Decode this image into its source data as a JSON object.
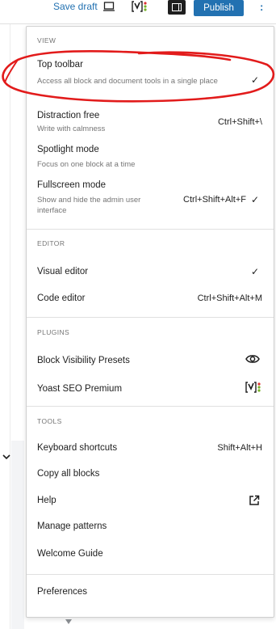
{
  "toolbar": {
    "save_draft": "Save draft",
    "publish": "Publish",
    "more_menu": ":"
  },
  "menu": {
    "sections": {
      "view": "VIEW",
      "editor": "EDITOR",
      "plugins": "PLUGINS",
      "tools": "TOOLS"
    },
    "view_items": {
      "top_toolbar": {
        "label": "Top toolbar",
        "desc": "Access all block and document tools in a single place",
        "check": "✓"
      },
      "distraction_free": {
        "label": "Distraction free",
        "desc": "Write with calmness",
        "shortcut": "Ctrl+Shift+\\"
      },
      "spotlight": {
        "label": "Spotlight mode",
        "desc": "Focus on one block at a time"
      },
      "fullscreen": {
        "label": "Fullscreen mode",
        "desc": "Show and hide the admin user interface",
        "shortcut": "Ctrl+Shift+Alt+F",
        "check": "✓"
      }
    },
    "editor_items": {
      "visual": {
        "label": "Visual editor",
        "check": "✓"
      },
      "code": {
        "label": "Code editor",
        "shortcut": "Ctrl+Shift+Alt+M"
      }
    },
    "plugin_items": {
      "block_visibility": {
        "label": "Block Visibility Presets",
        "icon": "eye-icon"
      },
      "yoast": {
        "label": "Yoast SEO Premium",
        "icon": "yoast-icon"
      }
    },
    "tool_items": {
      "keyboard": {
        "label": "Keyboard shortcuts",
        "shortcut": "Shift+Alt+H"
      },
      "copy": {
        "label": "Copy all blocks"
      },
      "help": {
        "label": "Help",
        "icon": "external-link-icon"
      },
      "patterns": {
        "label": "Manage patterns"
      },
      "welcome": {
        "label": "Welcome Guide"
      }
    },
    "preferences": {
      "label": "Preferences"
    }
  },
  "colors": {
    "accent": "#2271b1",
    "annotation": "#e21b1b",
    "yoast_purple": "#a4286a",
    "yoast_green": "#77b227",
    "yoast_red": "#dc3232"
  }
}
